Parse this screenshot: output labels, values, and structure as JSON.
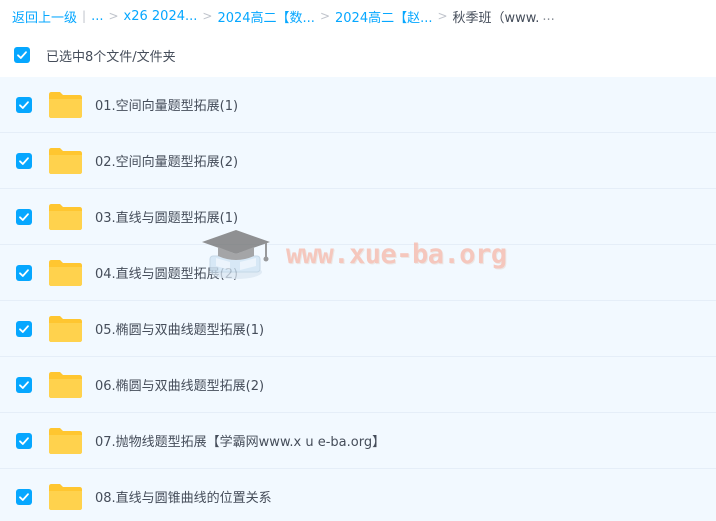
{
  "breadcrumb": {
    "back_label": "返回上一级",
    "divider": "|",
    "first_ellipsis": "...",
    "items": [
      {
        "label": "x26 2024..."
      },
      {
        "label": "2024高二【数..."
      },
      {
        "label": "2024高二【赵..."
      }
    ],
    "current": "秋季班（www.",
    "current_ellipsis": "..."
  },
  "selection": {
    "label": "已选中8个文件/文件夹",
    "checked": true
  },
  "files": [
    {
      "name": "01.空间向量题型拓展(1)",
      "type": "folder",
      "checked": true
    },
    {
      "name": "02.空间向量题型拓展(2)",
      "type": "folder",
      "checked": true
    },
    {
      "name": "03.直线与圆题型拓展(1)",
      "type": "folder",
      "checked": true
    },
    {
      "name": "04.直线与圆题型拓展(2)",
      "type": "folder",
      "checked": true
    },
    {
      "name": "05.椭圆与双曲线题型拓展(1)",
      "type": "folder",
      "checked": true
    },
    {
      "name": "06.椭圆与双曲线题型拓展(2)",
      "type": "folder",
      "checked": true
    },
    {
      "name": "07.抛物线题型拓展【学霸网www.x u e-ba.org】",
      "type": "folder",
      "checked": true
    },
    {
      "name": "08.直线与圆锥曲线的位置关系",
      "type": "folder",
      "checked": true
    }
  ],
  "watermark": {
    "text": "www.xue-ba.org"
  },
  "colors": {
    "accent": "#06a7ff",
    "row_background": "#f2f9ff",
    "folder": "#ffd24d",
    "text": "#454d5a",
    "watermark": "#f6b7a8"
  },
  "icons": {
    "checkbox": "checkmark-icon",
    "folder": "folder-icon",
    "watermark_logo": "graduation-cap-icon"
  }
}
